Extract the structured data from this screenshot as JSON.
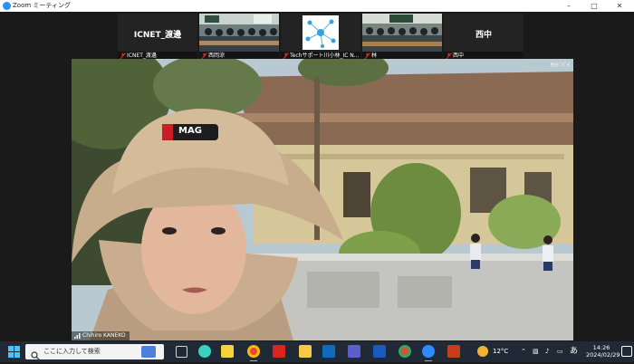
{
  "window": {
    "title": "Zoom ミーティング",
    "controls": [
      "minimize-icon",
      "maximize-icon",
      "close-icon"
    ]
  },
  "gallery": [
    {
      "big_text": "ICNET_渡邊",
      "name": "ICNET_渡邊",
      "kind": "text"
    },
    {
      "big_text": "",
      "name": "西岡涼",
      "kind": "classroom"
    },
    {
      "big_text": "",
      "name": "Techサポート川小林_IC N...",
      "kind": "logo"
    },
    {
      "big_text": "",
      "name": "林",
      "kind": "classroom"
    },
    {
      "big_text": "西中",
      "name": "西中",
      "kind": "text"
    }
  ],
  "main_video": {
    "speaker_name": "Chihiro KANEKO",
    "corner_text": "ｻｲﾄﾞﾊﾞｲ",
    "hat_text": "MAG"
  },
  "taskbar": {
    "search_placeholder": "ここに入力して検索",
    "weather": "12°C",
    "ime": "あ",
    "time": "14:26",
    "date": "2024/02/29",
    "apps": [
      "task-view-icon",
      "copilot-icon",
      "sticky-notes-icon",
      "chrome-icon",
      "acrobat-icon",
      "file-explorer-icon",
      "outlook-icon",
      "teams-icon",
      "word-icon",
      "chrome-icon",
      "zoom-icon",
      "powerpoint-icon"
    ]
  },
  "colors": {
    "taskbar_bg": "#202a36",
    "zoom_bg": "#1a1a1a",
    "zoom_blue": "#2d8cff",
    "mic_muted": "#e02828"
  }
}
